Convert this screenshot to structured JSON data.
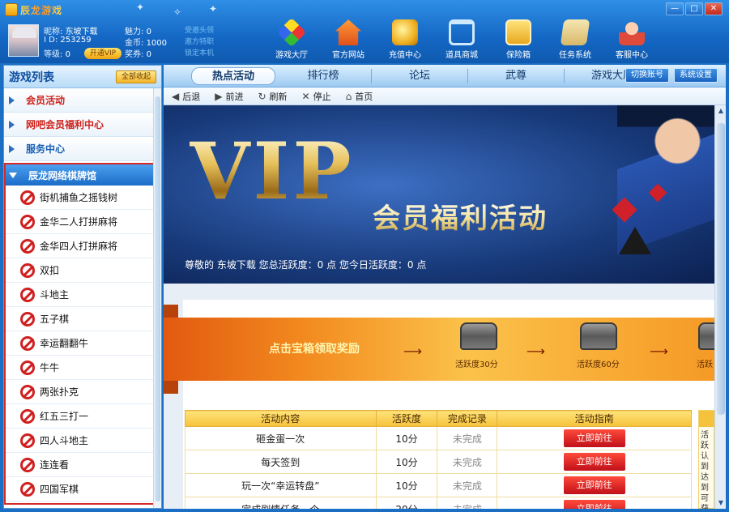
{
  "app": {
    "title": "辰龙游戏"
  },
  "window": {
    "min": "—",
    "max": "□",
    "close": "✕"
  },
  "user": {
    "nick_label": "昵称:",
    "nick": "东坡下载",
    "id_label": "I D:",
    "id": "253259",
    "level_label": "等级:",
    "level": "0",
    "charm_label": "魅力:",
    "charm": "0",
    "gold_label": "金币:",
    "gold": "1000",
    "ticket_label": "奖券:",
    "ticket": "0",
    "vip_button": "开通VIP",
    "link1": "受邀头领",
    "link2": "邀方特职",
    "link3": "锁定本机"
  },
  "toolbar": [
    {
      "label": "游戏大厅",
      "icon": "cube-icon"
    },
    {
      "label": "官方网站",
      "icon": "house-icon"
    },
    {
      "label": "充值中心",
      "icon": "coin-icon"
    },
    {
      "label": "道具商城",
      "icon": "cart-icon"
    },
    {
      "label": "保险箱",
      "icon": "safe-icon"
    },
    {
      "label": "任务系统",
      "icon": "task-icon"
    },
    {
      "label": "客服中心",
      "icon": "customer-service-icon"
    }
  ],
  "sidebar": {
    "title": "游戏列表",
    "collapse_label": "全部收起",
    "sections": [
      "会员活动",
      "网吧会员福利中心",
      "服务中心"
    ],
    "group": "辰龙网络棋牌馆",
    "games": [
      "街机捕鱼之摇钱树",
      "金华二人打拼麻将",
      "金华四人打拼麻将",
      "双扣",
      "斗地主",
      "五子棋",
      "幸运翻翻牛",
      "牛牛",
      "两张扑克",
      "红五三打一",
      "四人斗地主",
      "连连看",
      "四国军棋"
    ]
  },
  "tabs": [
    "热点活动",
    "排行榜",
    "论坛",
    "武尊",
    "游戏大厅"
  ],
  "tab_buttons": {
    "switch_account": "切换账号",
    "settings": "系统设置"
  },
  "nav": {
    "back": "后退",
    "forward": "前进",
    "refresh": "刷新",
    "stop": "停止",
    "home": "首页"
  },
  "banner": {
    "vip": "VIP",
    "subtitle": "会员福利活动",
    "greeting": "尊敬的 东坡下载 您总活跃度：0 点 您今日活跃度：0 点"
  },
  "reward": {
    "prompt": "点击宝箱领取奖励",
    "chests": [
      "活跃度30分",
      "活跃度60分",
      "活跃"
    ]
  },
  "activity_table": {
    "headers": [
      "活动内容",
      "活跃度",
      "完成记录",
      "活动指南"
    ],
    "rows": [
      {
        "content": "砸金蛋一次",
        "points": "10分",
        "status": "未完成",
        "action": "立即前往"
      },
      {
        "content": "每天签到",
        "points": "10分",
        "status": "未完成",
        "action": "立即前往"
      },
      {
        "content": "玩一次“幸运转盘”",
        "points": "10分",
        "status": "未完成",
        "action": "立即前往"
      },
      {
        "content": "完成剧情任务一个",
        "points": "20分",
        "status": "未完成",
        "action": "立即前往"
      }
    ],
    "side_note": "活跃认到达到可获金币"
  }
}
